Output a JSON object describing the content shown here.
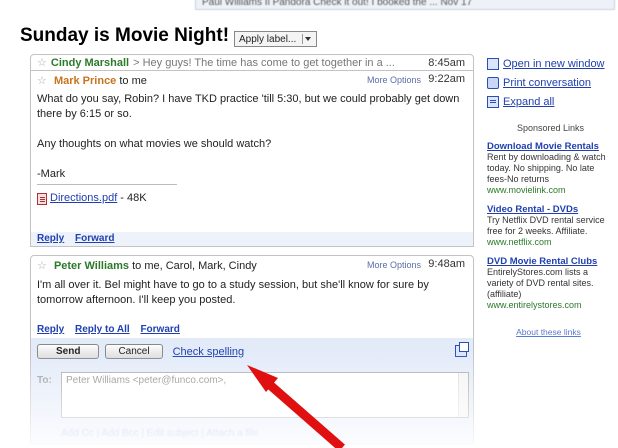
{
  "top_strip": {
    "text": "Paul Williams    Il Pandora  Check it out! I booked the ... Nov 17"
  },
  "title": "Sunday is Movie Night!",
  "apply_label": "Apply label...",
  "messages": [
    {
      "sender": "Cindy Marshall",
      "snippet": "> Hey guys! The time has come to get together in a ...",
      "time": "8:45am"
    },
    {
      "sender": "Mark Prince",
      "recipients": "to me",
      "more_options": "More Options",
      "time": "9:22am",
      "paragraphs": [
        "What do you say, Robin? I have TKD practice 'till 5:30, but we could probably get down there by 6:15 or so.",
        "Any thoughts on what movies we should watch?",
        "-Mark"
      ],
      "attachment_name": "Directions.pdf",
      "attachment_size": "- 48K",
      "actions": [
        "Reply",
        "Forward"
      ]
    },
    {
      "sender": "Peter Williams",
      "recipients": "to me, Carol, Mark, Cindy",
      "more_options": "More Options",
      "time": "9:48am",
      "body": "I'm all over it. Bel might have to go to a study session, but she'll know for sure by tomorrow afternoon. I'll keep you posted.",
      "actions": [
        "Reply",
        "Reply to All",
        "Forward"
      ]
    }
  ],
  "compose": {
    "send_label": "Send",
    "cancel_label": "Cancel",
    "check_spelling": "Check spelling",
    "to_label": "To:",
    "to_value": "Peter Williams <peter@funco.com>,",
    "extra_links": "Add Cc | Add Bcc | Edit subject | Attach a file"
  },
  "sidebar": {
    "links": [
      "Open in new window",
      "Print conversation",
      "Expand all"
    ],
    "sponsored_heading": "Sponsored Links",
    "ads": [
      {
        "title": "Download Movie Rentals",
        "text": "Rent by downloading & watch today. No shipping. No late fees-No returns",
        "url": "www.movielink.com"
      },
      {
        "title": "Video Rental - DVDs",
        "text": "Try Netflix DVD rental service free for 2 weeks. Affiliate.",
        "url": "www.netflix.com"
      },
      {
        "title": "DVD Movie Rental Clubs",
        "text": "EntirelyStores.com lists a variety of DVD rental sites. (affiliate)",
        "url": "www.entirelystores.com"
      }
    ],
    "about": "About these links"
  },
  "colors": {
    "link": "#2040b0",
    "sender_green": "#2a7a2a",
    "sender_orange": "#c9741c",
    "compose_bg": "#e3ebf9",
    "annotation_arrow": "#e01010"
  }
}
